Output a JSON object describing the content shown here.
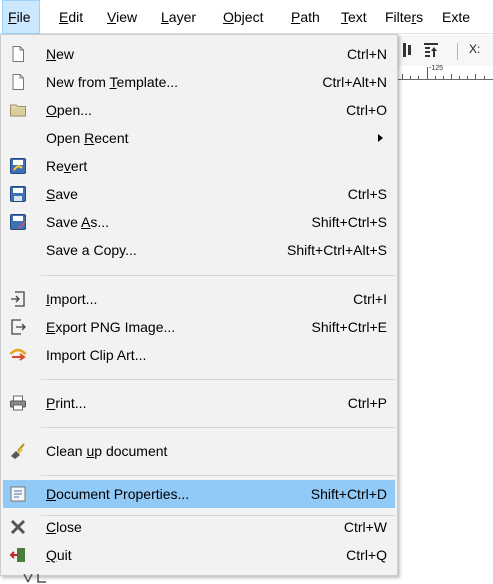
{
  "menubar": {
    "items": [
      {
        "pre": "",
        "ul": "F",
        "post": "ile"
      },
      {
        "pre": "",
        "ul": "E",
        "post": "dit"
      },
      {
        "pre": "",
        "ul": "V",
        "post": "iew"
      },
      {
        "pre": "",
        "ul": "L",
        "post": "ayer"
      },
      {
        "pre": "",
        "ul": "O",
        "post": "bject"
      },
      {
        "pre": "",
        "ul": "P",
        "post": "ath"
      },
      {
        "pre": "",
        "ul": "T",
        "post": "ext"
      },
      {
        "pre": "Filte",
        "ul": "r",
        "post": "s"
      },
      {
        "pre": "Exte",
        "ul": "",
        "post": ""
      }
    ]
  },
  "toolbar": {
    "x_label": "X:"
  },
  "ruler": {
    "label": "-125"
  },
  "file_menu": {
    "items": [
      {
        "pre": "",
        "ul": "N",
        "post": "ew",
        "shortcut": "Ctrl+N",
        "icon": "new-document-icon"
      },
      {
        "pre": "New from ",
        "ul": "T",
        "post": "emplate...",
        "shortcut": "Ctrl+Alt+N",
        "icon": "template-icon"
      },
      {
        "pre": "",
        "ul": "O",
        "post": "pen...",
        "shortcut": "Ctrl+O",
        "icon": "folder-open-icon"
      },
      {
        "pre": "Open ",
        "ul": "R",
        "post": "ecent",
        "shortcut": "",
        "icon": ""
      },
      {
        "pre": "Re",
        "ul": "v",
        "post": "ert",
        "shortcut": "",
        "icon": "revert-icon"
      },
      {
        "pre": "",
        "ul": "S",
        "post": "ave",
        "shortcut": "Ctrl+S",
        "icon": "save-icon"
      },
      {
        "pre": "Save ",
        "ul": "A",
        "post": "s...",
        "shortcut": "Shift+Ctrl+S",
        "icon": "save-as-icon"
      },
      {
        "pre": "Save a Copy...",
        "ul": "",
        "post": "",
        "shortcut": "Shift+Ctrl+Alt+S",
        "icon": ""
      },
      {
        "pre": "",
        "ul": "I",
        "post": "mport...",
        "shortcut": "Ctrl+I",
        "icon": "import-icon"
      },
      {
        "pre": "",
        "ul": "E",
        "post": "xport PNG Image...",
        "shortcut": "Shift+Ctrl+E",
        "icon": "export-png-icon"
      },
      {
        "pre": "Import Clip Art...",
        "ul": "",
        "post": "",
        "shortcut": "",
        "icon": "clip-art-icon"
      },
      {
        "pre": "",
        "ul": "P",
        "post": "rint...",
        "shortcut": "Ctrl+P",
        "icon": "print-icon"
      },
      {
        "pre": "Clean ",
        "ul": "u",
        "post": "p document",
        "shortcut": "",
        "icon": "clean-up-icon"
      },
      {
        "pre": "",
        "ul": "D",
        "post": "ocument Properties...",
        "shortcut": "Shift+Ctrl+D",
        "icon": "document-properties-icon"
      },
      {
        "pre": "",
        "ul": "C",
        "post": "lose",
        "shortcut": "Ctrl+W",
        "icon": "close-icon"
      },
      {
        "pre": "",
        "ul": "Q",
        "post": "uit",
        "shortcut": "Ctrl+Q",
        "icon": "quit-icon"
      }
    ]
  },
  "colors": {
    "menu_bg": "#f2f2f2",
    "highlight": "#91c9f7",
    "menubar_active_bg": "#cce8ff",
    "separator": "#d7d7d7"
  }
}
